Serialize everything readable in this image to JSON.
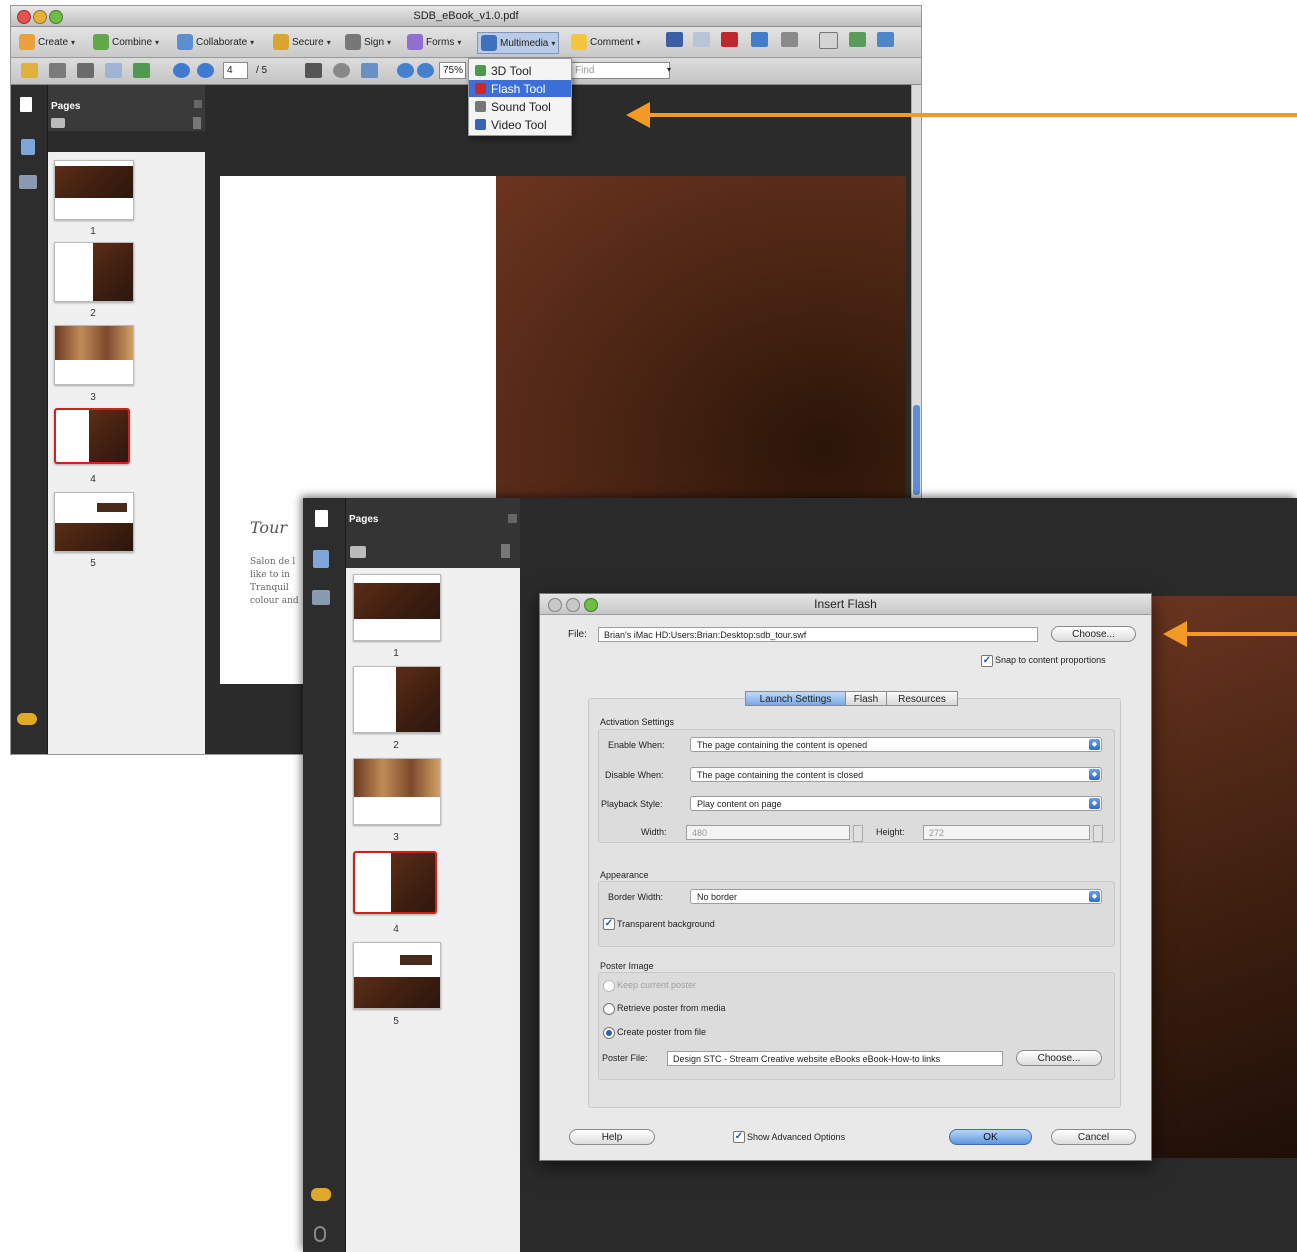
{
  "window1": {
    "title": "SDB_eBook_v1.0.pdf",
    "toolbar": {
      "create": "Create",
      "combine": "Combine",
      "collaborate": "Collaborate",
      "secure": "Secure",
      "sign": "Sign",
      "forms": "Forms",
      "multimedia": "Multimedia",
      "comment": "Comment"
    },
    "nav": {
      "page_value": "4",
      "page_total": "/ 5",
      "zoom_value": "75%",
      "find_placeholder": "Find"
    },
    "panel_title": "Pages",
    "thumbnails": [
      "1",
      "2",
      "3",
      "4",
      "5"
    ],
    "multimedia_menu": [
      "3D Tool",
      "Flash Tool",
      "Sound Tool",
      "Video Tool"
    ],
    "highlighted_menu_item": "Flash Tool",
    "doc_text": {
      "heading": "Tour",
      "lines": [
        "Salon de l",
        "like to in",
        "Tranquil",
        "colour and"
      ]
    }
  },
  "window2": {
    "panel_title": "Pages",
    "thumbnails": [
      "1",
      "2",
      "3",
      "4",
      "5"
    ]
  },
  "dialog": {
    "title": "Insert Flash",
    "file_label": "File:",
    "file_value": "Brian's iMac HD:Users:Brian:Desktop:sdb_tour.swf",
    "choose": "Choose...",
    "snap_label": "Snap to content proportions",
    "snap_checked": true,
    "tabs": [
      "Launch Settings",
      "Flash",
      "Resources"
    ],
    "active_tab": "Launch Settings",
    "activation": {
      "group_title": "Activation Settings",
      "enable_label": "Enable When:",
      "enable_value": "The page containing the content is opened",
      "disable_label": "Disable When:",
      "disable_value": "The page containing the content is closed",
      "playback_label": "Playback Style:",
      "playback_value": "Play content on page",
      "width_label": "Width:",
      "width_value": "480",
      "height_label": "Height:",
      "height_value": "272"
    },
    "appearance": {
      "group_title": "Appearance",
      "border_label": "Border Width:",
      "border_value": "No border",
      "transparent_label": "Transparent background",
      "transparent_checked": true
    },
    "poster": {
      "group_title": "Poster Image",
      "keep": "Keep current poster",
      "retrieve": "Retrieve poster from media",
      "create": "Create poster from file",
      "selected": "Create poster from file",
      "file_label": "Poster File:",
      "file_value": "Design STC - Stream Creative website eBooks eBook-How-to links",
      "choose": "Choose..."
    },
    "help": "Help",
    "advanced_label": "Show Advanced Options",
    "advanced_checked": true,
    "ok": "OK",
    "cancel": "Cancel"
  },
  "colors": {
    "arrow": "#f39a26",
    "highlight": "#3d6fd8",
    "selected_thumb_border": "#d21f1f",
    "dark_panel": "#2b2b2b"
  }
}
